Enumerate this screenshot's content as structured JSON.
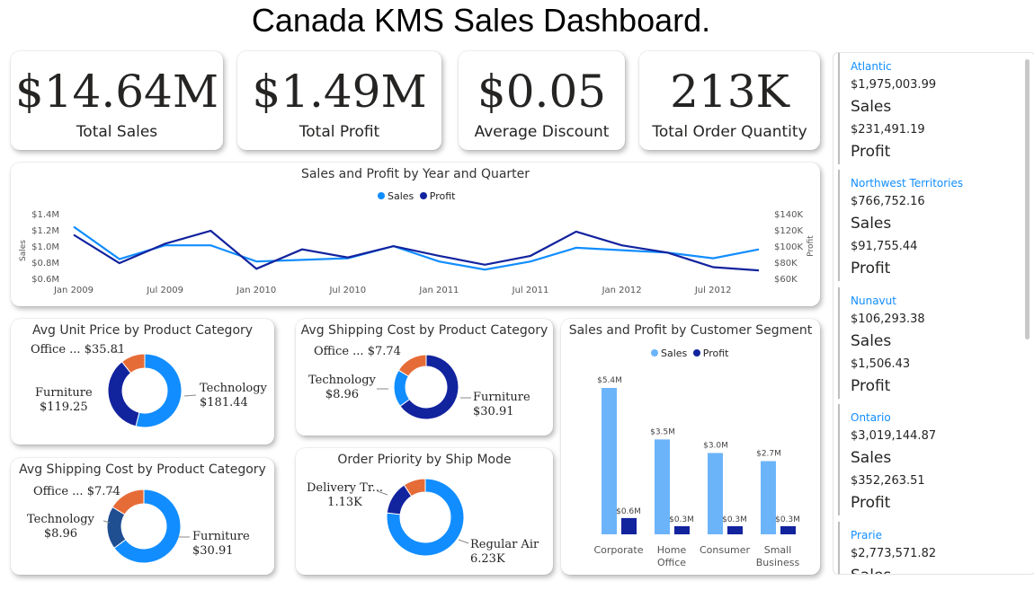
{
  "title": "Canada KMS Sales Dashboard.",
  "colors": {
    "sales": "#118dff",
    "profit": "#12239e",
    "orange": "#e66c37",
    "navy_dark": "#1f4e91",
    "sales_light": "#6cb4fa"
  },
  "kpis": [
    {
      "value": "$14.64M",
      "label": "Total Sales"
    },
    {
      "value": "$1.49M",
      "label": "Total Profit"
    },
    {
      "value": "$0.05",
      "label": "Average Discount"
    },
    {
      "value": "213K",
      "label": "Total Order Quantity"
    }
  ],
  "line_chart": {
    "title": "Sales and Profit by Year and Quarter",
    "legend": [
      "Sales",
      "Profit"
    ],
    "y_left_label": "Sales",
    "y_right_label": "Profit",
    "y_left_ticks": [
      "$1.4M",
      "$1.2M",
      "$1.0M",
      "$0.8M",
      "$0.6M"
    ],
    "y_right_ticks": [
      "$140K",
      "$120K",
      "$100K",
      "$80K",
      "$60K"
    ],
    "x_ticks": [
      "Jan 2009",
      "Jul 2009",
      "Jan 2010",
      "Jul 2010",
      "Jan 2011",
      "Jul 2011",
      "Jan 2012",
      "Jul 2012"
    ]
  },
  "donut_price": {
    "title": "Avg Unit Price by Product Category",
    "labels": [
      {
        "name": "Office ...",
        "value": "$35.81"
      },
      {
        "name": "Furniture",
        "value": "$119.25"
      },
      {
        "name": "Technology",
        "value": "$181.44"
      }
    ]
  },
  "donut_ship_top": {
    "title": "Avg Shipping Cost by Product Category",
    "labels": [
      {
        "name": "Office ...",
        "value": "$7.74"
      },
      {
        "name": "Technology",
        "value": "$8.96"
      },
      {
        "name": "Furniture",
        "value": "$30.91"
      }
    ]
  },
  "donut_ship_bottom": {
    "title": "Avg Shipping Cost by Product Category",
    "labels": [
      {
        "name": "Office ...",
        "value": "$7.74"
      },
      {
        "name": "Technology",
        "value": "$8.96"
      },
      {
        "name": "Furniture",
        "value": "$30.91"
      }
    ]
  },
  "donut_priority": {
    "title": "Order Priority by Ship Mode",
    "labels": [
      {
        "name": "Delivery Tr...",
        "value": "1.13K"
      },
      {
        "name": "Regular Air",
        "value": "6.23K"
      }
    ]
  },
  "bar_chart": {
    "title": "Sales and Profit by Customer Segment",
    "legend": [
      "Sales",
      "Profit"
    ]
  },
  "chart_data": [
    {
      "type": "line",
      "title": "Sales and Profit by Year and Quarter",
      "x": [
        "2009 Q1",
        "2009 Q2",
        "2009 Q3",
        "2009 Q4",
        "2010 Q1",
        "2010 Q2",
        "2010 Q3",
        "2010 Q4",
        "2011 Q1",
        "2011 Q2",
        "2011 Q3",
        "2011 Q4",
        "2012 Q1",
        "2012 Q2",
        "2012 Q3",
        "2012 Q4"
      ],
      "series": [
        {
          "name": "Sales",
          "axis": "left",
          "values": [
            1.25,
            0.85,
            1.02,
            1.02,
            0.82,
            0.84,
            0.86,
            1.01,
            0.82,
            0.72,
            0.82,
            0.99,
            0.96,
            0.93,
            0.86,
            0.97
          ]
        },
        {
          "name": "Profit",
          "axis": "right",
          "values": [
            115,
            80,
            104,
            120,
            73,
            97,
            87,
            101,
            89,
            78,
            89,
            119,
            102,
            93,
            75,
            71
          ]
        }
      ],
      "y_left_range": [
        0.6,
        1.4
      ],
      "y_right_range": [
        60,
        140
      ],
      "legend": "top-center"
    },
    {
      "type": "pie",
      "title": "Avg Unit Price by Product Category",
      "categories": [
        "Technology",
        "Furniture",
        "Office ..."
      ],
      "values": [
        181.44,
        119.25,
        35.81
      ]
    },
    {
      "type": "pie",
      "title": "Avg Shipping Cost by Product Category",
      "categories": [
        "Furniture",
        "Technology",
        "Office ..."
      ],
      "values": [
        30.91,
        8.96,
        7.74
      ]
    },
    {
      "type": "pie",
      "title": "Avg Shipping Cost by Product Category",
      "categories": [
        "Furniture",
        "Technology",
        "Office ..."
      ],
      "values": [
        30.91,
        8.96,
        7.74
      ]
    },
    {
      "type": "pie",
      "title": "Order Priority by Ship Mode",
      "categories": [
        "Regular Air",
        "Delivery Tr...",
        ""
      ],
      "values": [
        6.23,
        1.13,
        0.75
      ]
    },
    {
      "type": "bar",
      "title": "Sales and Profit by Customer Segment",
      "categories": [
        "Corporate",
        "Home Office",
        "Consumer",
        "Small Business"
      ],
      "series": [
        {
          "name": "Sales",
          "values": [
            5.4,
            3.5,
            3.0,
            2.7
          ],
          "labels": [
            "$5.4M",
            "$3.5M",
            "$3.0M",
            "$2.7M"
          ]
        },
        {
          "name": "Profit",
          "values": [
            0.6,
            0.3,
            0.3,
            0.3
          ],
          "labels": [
            "$0.6M",
            "$0.3M",
            "$0.3M",
            "$0.3M"
          ]
        }
      ],
      "legend": "top-center"
    }
  ],
  "regions": [
    {
      "name": "Atlantic",
      "sales": "$1,975,003.99",
      "sales_label": "Sales",
      "profit": "$231,491.19",
      "profit_label": "Profit"
    },
    {
      "name": "Northwest Territories",
      "sales": "$766,752.16",
      "sales_label": "Sales",
      "profit": "$91,755.44",
      "profit_label": "Profit"
    },
    {
      "name": "Nunavut",
      "sales": "$106,293.38",
      "sales_label": "Sales",
      "profit": "$1,506.43",
      "profit_label": "Profit"
    },
    {
      "name": "Ontario",
      "sales": "$3,019,144.87",
      "sales_label": "Sales",
      "profit": "$352,263.51",
      "profit_label": "Profit"
    },
    {
      "name": "Prarie",
      "sales": "$2,773,571.82",
      "sales_label": "Sales",
      "profit": "",
      "profit_label": ""
    }
  ]
}
